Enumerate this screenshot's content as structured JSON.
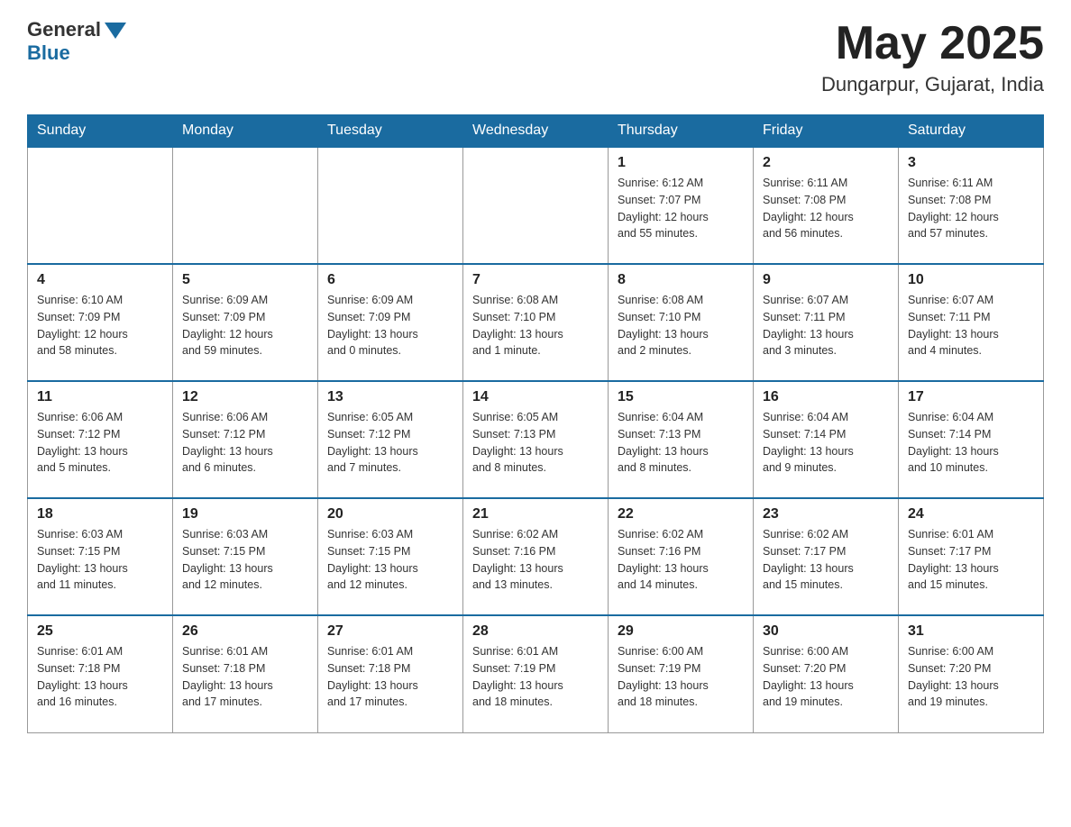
{
  "header": {
    "logo_text": "General",
    "logo_blue": "Blue",
    "month": "May 2025",
    "location": "Dungarpur, Gujarat, India"
  },
  "days_of_week": [
    "Sunday",
    "Monday",
    "Tuesday",
    "Wednesday",
    "Thursday",
    "Friday",
    "Saturday"
  ],
  "weeks": [
    [
      {
        "day": "",
        "info": ""
      },
      {
        "day": "",
        "info": ""
      },
      {
        "day": "",
        "info": ""
      },
      {
        "day": "",
        "info": ""
      },
      {
        "day": "1",
        "info": "Sunrise: 6:12 AM\nSunset: 7:07 PM\nDaylight: 12 hours\nand 55 minutes."
      },
      {
        "day": "2",
        "info": "Sunrise: 6:11 AM\nSunset: 7:08 PM\nDaylight: 12 hours\nand 56 minutes."
      },
      {
        "day": "3",
        "info": "Sunrise: 6:11 AM\nSunset: 7:08 PM\nDaylight: 12 hours\nand 57 minutes."
      }
    ],
    [
      {
        "day": "4",
        "info": "Sunrise: 6:10 AM\nSunset: 7:09 PM\nDaylight: 12 hours\nand 58 minutes."
      },
      {
        "day": "5",
        "info": "Sunrise: 6:09 AM\nSunset: 7:09 PM\nDaylight: 12 hours\nand 59 minutes."
      },
      {
        "day": "6",
        "info": "Sunrise: 6:09 AM\nSunset: 7:09 PM\nDaylight: 13 hours\nand 0 minutes."
      },
      {
        "day": "7",
        "info": "Sunrise: 6:08 AM\nSunset: 7:10 PM\nDaylight: 13 hours\nand 1 minute."
      },
      {
        "day": "8",
        "info": "Sunrise: 6:08 AM\nSunset: 7:10 PM\nDaylight: 13 hours\nand 2 minutes."
      },
      {
        "day": "9",
        "info": "Sunrise: 6:07 AM\nSunset: 7:11 PM\nDaylight: 13 hours\nand 3 minutes."
      },
      {
        "day": "10",
        "info": "Sunrise: 6:07 AM\nSunset: 7:11 PM\nDaylight: 13 hours\nand 4 minutes."
      }
    ],
    [
      {
        "day": "11",
        "info": "Sunrise: 6:06 AM\nSunset: 7:12 PM\nDaylight: 13 hours\nand 5 minutes."
      },
      {
        "day": "12",
        "info": "Sunrise: 6:06 AM\nSunset: 7:12 PM\nDaylight: 13 hours\nand 6 minutes."
      },
      {
        "day": "13",
        "info": "Sunrise: 6:05 AM\nSunset: 7:12 PM\nDaylight: 13 hours\nand 7 minutes."
      },
      {
        "day": "14",
        "info": "Sunrise: 6:05 AM\nSunset: 7:13 PM\nDaylight: 13 hours\nand 8 minutes."
      },
      {
        "day": "15",
        "info": "Sunrise: 6:04 AM\nSunset: 7:13 PM\nDaylight: 13 hours\nand 8 minutes."
      },
      {
        "day": "16",
        "info": "Sunrise: 6:04 AM\nSunset: 7:14 PM\nDaylight: 13 hours\nand 9 minutes."
      },
      {
        "day": "17",
        "info": "Sunrise: 6:04 AM\nSunset: 7:14 PM\nDaylight: 13 hours\nand 10 minutes."
      }
    ],
    [
      {
        "day": "18",
        "info": "Sunrise: 6:03 AM\nSunset: 7:15 PM\nDaylight: 13 hours\nand 11 minutes."
      },
      {
        "day": "19",
        "info": "Sunrise: 6:03 AM\nSunset: 7:15 PM\nDaylight: 13 hours\nand 12 minutes."
      },
      {
        "day": "20",
        "info": "Sunrise: 6:03 AM\nSunset: 7:15 PM\nDaylight: 13 hours\nand 12 minutes."
      },
      {
        "day": "21",
        "info": "Sunrise: 6:02 AM\nSunset: 7:16 PM\nDaylight: 13 hours\nand 13 minutes."
      },
      {
        "day": "22",
        "info": "Sunrise: 6:02 AM\nSunset: 7:16 PM\nDaylight: 13 hours\nand 14 minutes."
      },
      {
        "day": "23",
        "info": "Sunrise: 6:02 AM\nSunset: 7:17 PM\nDaylight: 13 hours\nand 15 minutes."
      },
      {
        "day": "24",
        "info": "Sunrise: 6:01 AM\nSunset: 7:17 PM\nDaylight: 13 hours\nand 15 minutes."
      }
    ],
    [
      {
        "day": "25",
        "info": "Sunrise: 6:01 AM\nSunset: 7:18 PM\nDaylight: 13 hours\nand 16 minutes."
      },
      {
        "day": "26",
        "info": "Sunrise: 6:01 AM\nSunset: 7:18 PM\nDaylight: 13 hours\nand 17 minutes."
      },
      {
        "day": "27",
        "info": "Sunrise: 6:01 AM\nSunset: 7:18 PM\nDaylight: 13 hours\nand 17 minutes."
      },
      {
        "day": "28",
        "info": "Sunrise: 6:01 AM\nSunset: 7:19 PM\nDaylight: 13 hours\nand 18 minutes."
      },
      {
        "day": "29",
        "info": "Sunrise: 6:00 AM\nSunset: 7:19 PM\nDaylight: 13 hours\nand 18 minutes."
      },
      {
        "day": "30",
        "info": "Sunrise: 6:00 AM\nSunset: 7:20 PM\nDaylight: 13 hours\nand 19 minutes."
      },
      {
        "day": "31",
        "info": "Sunrise: 6:00 AM\nSunset: 7:20 PM\nDaylight: 13 hours\nand 19 minutes."
      }
    ]
  ]
}
